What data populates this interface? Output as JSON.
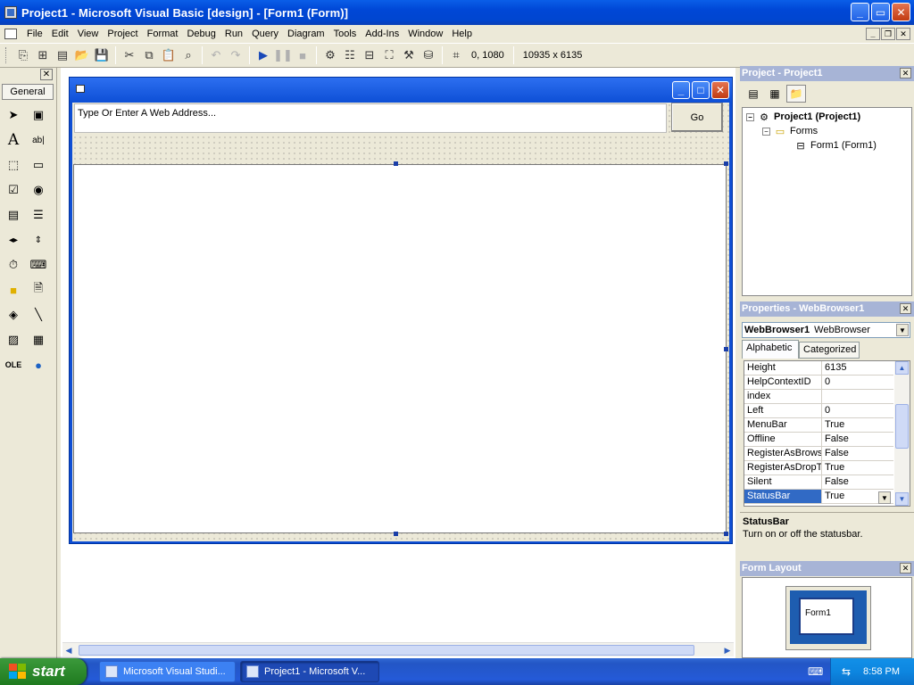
{
  "window": {
    "title": "Project1 - Microsoft Visual Basic [design] - [Form1 (Form)]",
    "buttons": {
      "minimize": "_",
      "maximize": "▫",
      "close": "✕"
    }
  },
  "menubar": {
    "items": [
      "File",
      "Edit",
      "View",
      "Project",
      "Format",
      "Debug",
      "Run",
      "Query",
      "Diagram",
      "Tools",
      "Add-Ins",
      "Window",
      "Help"
    ],
    "accelerators": [
      "F",
      "E",
      "V",
      "P",
      "o",
      "D",
      "R",
      "u",
      "i",
      "T",
      "A",
      "W",
      "H"
    ]
  },
  "toolbar": {
    "position_readout": "0, 1080",
    "size_readout": "10935 x 6135",
    "icons": [
      "add-project-icon",
      "add-form-icon",
      "menu-editor-icon",
      "open-icon",
      "save-icon",
      "cut-icon",
      "copy-icon",
      "paste-icon",
      "find-icon",
      "undo-icon",
      "redo-icon",
      "start-icon",
      "break-icon",
      "end-icon",
      "project-explorer-icon",
      "properties-icon",
      "form-layout-icon",
      "object-browser-icon",
      "toolbox-icon",
      "data-view-icon",
      "position-icon",
      "size-icon"
    ]
  },
  "toolbox": {
    "tab_label": "General",
    "tools": [
      "pointer",
      "picturebox",
      "label",
      "textbox",
      "frame",
      "commandbutton",
      "checkbox",
      "optionbutton",
      "combobox",
      "listbox",
      "hscrollbar",
      "vscrollbar",
      "timer",
      "drivelistbox",
      "dirlistbox",
      "filelistbox",
      "shape",
      "line",
      "image",
      "data",
      "ole",
      "webbrowser"
    ]
  },
  "form": {
    "address_placeholder": "Type Or Enter A Web Address...",
    "go_label": "Go"
  },
  "project_panel": {
    "title": "Project - Project1",
    "tree": {
      "root": "Project1 (Project1)",
      "folder": "Forms",
      "item": "Form1 (Form1)"
    }
  },
  "properties_panel": {
    "title": "Properties - WebBrowser1",
    "object_name": "WebBrowser1",
    "object_type": "WebBrowser",
    "tabs": [
      "Alphabetic",
      "Categorized"
    ],
    "rows": [
      {
        "name": "Height",
        "value": "6135"
      },
      {
        "name": "HelpContextID",
        "value": "0"
      },
      {
        "name": "index",
        "value": ""
      },
      {
        "name": "Left",
        "value": "0"
      },
      {
        "name": "MenuBar",
        "value": "True"
      },
      {
        "name": "Offline",
        "value": "False"
      },
      {
        "name": "RegisterAsBrowser",
        "value": "False"
      },
      {
        "name": "RegisterAsDropTarget",
        "value": "True"
      },
      {
        "name": "Silent",
        "value": "False"
      },
      {
        "name": "StatusBar",
        "value": "True"
      }
    ],
    "selected_row": "StatusBar",
    "description_name": "StatusBar",
    "description_text": "Turn on or off the statusbar."
  },
  "form_layout_panel": {
    "title": "Form Layout",
    "mini_form_label": "Form1"
  },
  "taskbar": {
    "start_label": "start",
    "tasks": [
      "Microsoft Visual Studi...",
      "Project1 - Microsoft V..."
    ],
    "clock": "8:58 PM"
  },
  "colors": {
    "xp_blue": "#0047d6",
    "selection": "#316ac5",
    "start_green": "#2d8a2d"
  }
}
